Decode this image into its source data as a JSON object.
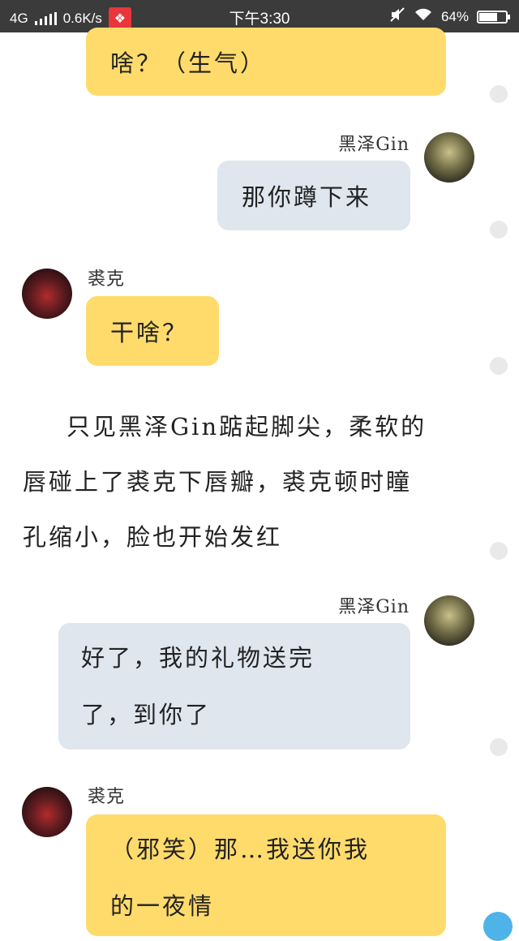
{
  "status_bar": {
    "network": "4G",
    "speed": "0.6K/s",
    "time": "下午3:30",
    "battery": "64%",
    "battery_level": 0.64
  },
  "messages": [
    {
      "sender": "",
      "side": "left",
      "color": "yellow",
      "text": "啥？（生气）"
    },
    {
      "sender": "黑泽Gin",
      "side": "right",
      "color": "gray",
      "text": "那你蹲下来"
    },
    {
      "sender": "裘克",
      "side": "left",
      "color": "yellow",
      "text": "干啥？"
    },
    {
      "type": "narration",
      "lines": [
        "只见黑泽Gin踮起脚尖，柔软的",
        "唇碰上了裘克下唇瓣，裘克顿时瞳",
        "孔缩小，脸也开始发红"
      ]
    },
    {
      "sender": "黑泽Gin",
      "side": "right",
      "color": "gray",
      "lines": [
        "好了，我的礼物送完",
        "了，到你了"
      ]
    },
    {
      "sender": "裘克",
      "side": "left",
      "color": "yellow",
      "lines": [
        "（邪笑）那…我送你我",
        "的一夜情"
      ]
    }
  ]
}
